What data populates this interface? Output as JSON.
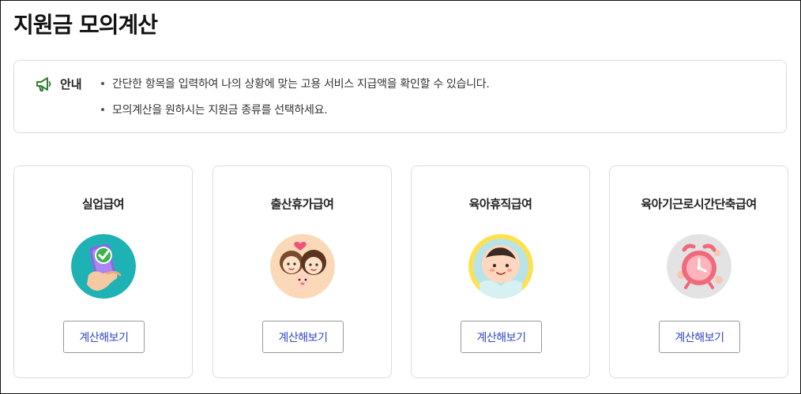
{
  "page": {
    "title": "지원금 모의계산"
  },
  "notice": {
    "icon": "megaphone-icon",
    "label": "안내",
    "items": [
      "간단한 항목을 입력하여 나의 상황에 맞는 고용 서비스 지급액을 확인할 수 있습니다.",
      "모의계산을 원하시는 지원금 종류를 선택하세요."
    ]
  },
  "cards": [
    {
      "title": "실업급여",
      "icon": "phone-check-illustration",
      "button": "계산해보기"
    },
    {
      "title": "출산휴가급여",
      "icon": "family-illustration",
      "button": "계산해보기"
    },
    {
      "title": "육아휴직급여",
      "icon": "baby-illustration",
      "button": "계산해보기"
    },
    {
      "title": "육아기근로시간단축급여",
      "icon": "alarm-clock-illustration",
      "button": "계산해보기"
    }
  ],
  "colors": {
    "accent_button_text": "#2f49c5",
    "notice_icon": "#2e7d32"
  }
}
